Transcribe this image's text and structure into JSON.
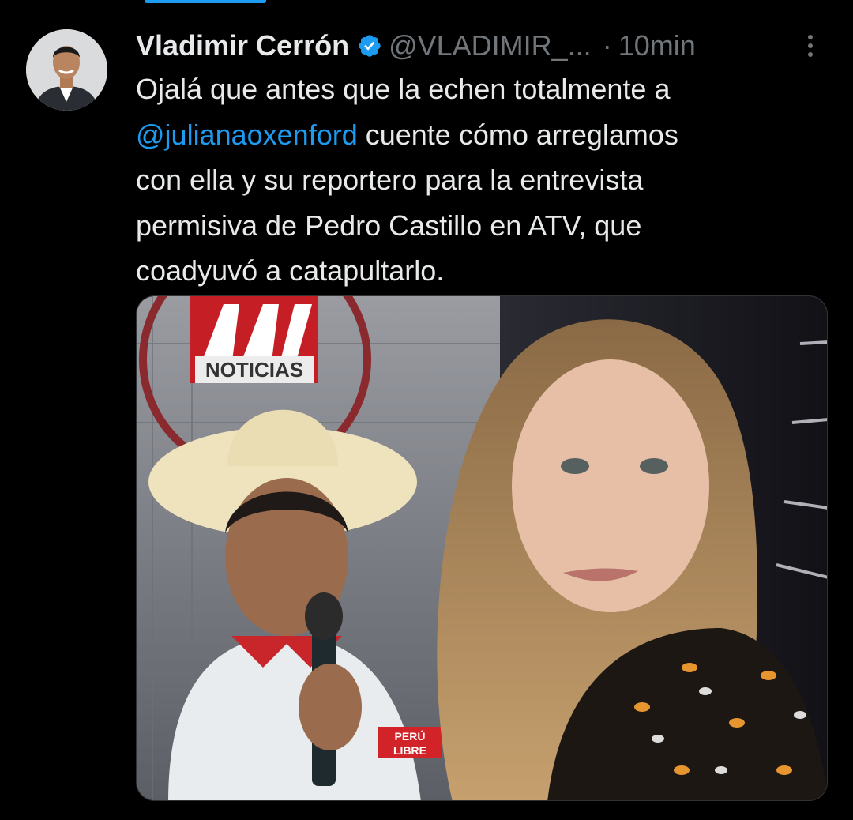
{
  "tweet": {
    "author": {
      "name": "Vladimir Cerrón",
      "handle": "@VLADIMIR_...",
      "verified": true
    },
    "separator": "·",
    "time": "10min",
    "text": {
      "line1": "Ojalá que antes que la echen totalmente a",
      "mention": "@julianaoxenford",
      "line2_rest": " cuente cómo arreglamos",
      "line3": "con ella y su reportero para la entrevista",
      "line4": "permisiva de Pedro Castillo en ATV, que",
      "line5": "coadyuvó a catapultarlo."
    },
    "media": {
      "logo_text": "NOTICIAS",
      "badge_text_1": "PERÚ",
      "badge_text_2": "LIBRE"
    }
  },
  "colors": {
    "background": "#000000",
    "text": "#e7e9ea",
    "muted": "#71767b",
    "link": "#1d9bf0",
    "verified": "#1d9bf0"
  },
  "icons": {
    "verified": "verified-badge-icon",
    "more": "more-dots-icon"
  }
}
